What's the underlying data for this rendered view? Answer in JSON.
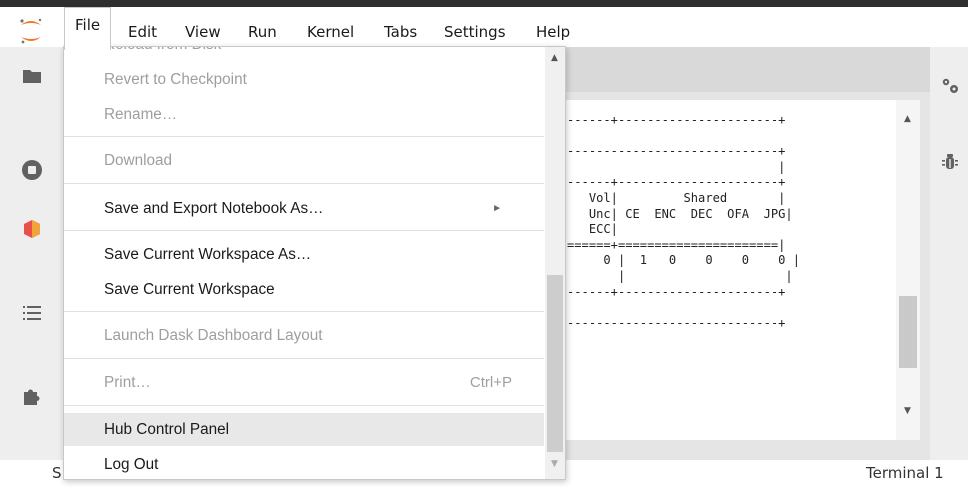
{
  "app": {
    "name": "JupyterLab"
  },
  "menubar": {
    "items": [
      "File",
      "Edit",
      "View",
      "Run",
      "Kernel",
      "Tabs",
      "Settings",
      "Help"
    ],
    "active": "File"
  },
  "left_sidebar": {
    "icons": [
      "folder-icon",
      "stop-circle-icon",
      "extension-cube-icon",
      "list-icon",
      "puzzle-icon"
    ]
  },
  "right_sidebar": {
    "icons": [
      "property-inspector-gears-icon",
      "debugger-bug-icon"
    ]
  },
  "file_menu": {
    "items": [
      {
        "label": "Reload from Disk",
        "disabled": true,
        "clipped": true
      },
      {
        "label": "Revert to Checkpoint",
        "disabled": true
      },
      {
        "label": "Rename…",
        "disabled": true
      },
      {
        "label": "Download",
        "disabled": true
      },
      {
        "label": "Save and Export Notebook As…",
        "disabled": false,
        "submenu": true
      },
      {
        "label": "Save Current Workspace As…",
        "disabled": false
      },
      {
        "label": "Save Current Workspace",
        "disabled": false
      },
      {
        "label": "Launch Dask Dashboard Layout",
        "disabled": true
      },
      {
        "label": "Print…",
        "disabled": true,
        "shortcut": "Ctrl+P"
      },
      {
        "label": "Hub Control Panel",
        "disabled": false,
        "highlighted": true
      },
      {
        "label": "Log Out",
        "disabled": false
      }
    ]
  },
  "terminal": {
    "lines": [
      "------+----------------------+",
      "",
      "-----------------------------+",
      "                             |",
      "------+----------------------+",
      "   Vol|         Shared       |",
      "   Unc| CE  ENC  DEC  OFA  JPG|",
      "   ECC|",
      "======+======================|",
      "     0 |  1   0    0    0    0 |",
      "       |                      |",
      "------+----------------------+",
      "",
      "-----------------------------+"
    ]
  },
  "statusbar": {
    "left": "S",
    "right": "Terminal 1"
  },
  "colors": {
    "topbar": "#2f2f31",
    "logo_orange": "#f37726",
    "sidebar_icon": "#616161",
    "extension_icon": "#e8514a",
    "menu_disabled": "#9e9e9e",
    "menu_highlight": "#e8e8e8"
  }
}
